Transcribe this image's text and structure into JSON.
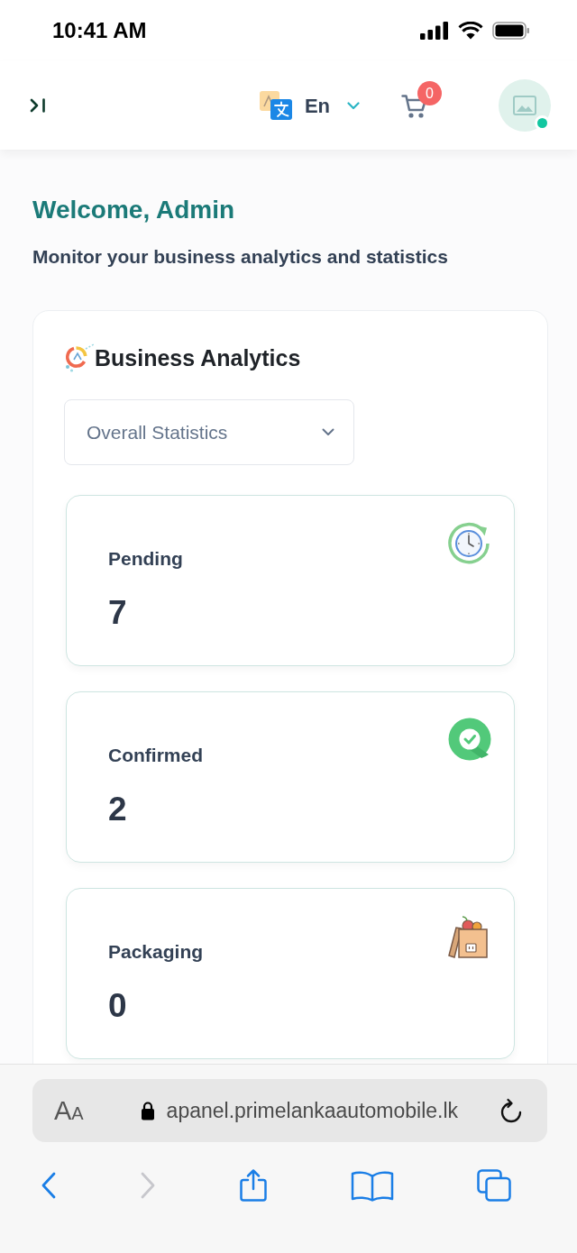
{
  "status_bar": {
    "time": "10:41 AM"
  },
  "header": {
    "language": {
      "label": "En"
    },
    "cart": {
      "count": "0"
    },
    "avatar": {
      "online": true
    }
  },
  "welcome": {
    "title": "Welcome, Admin",
    "subtitle": "Monitor your business analytics and statistics"
  },
  "analytics": {
    "title": "Business Analytics",
    "filter": {
      "value": "Overall Statistics"
    },
    "stats": [
      {
        "kind": "pending",
        "label": "Pending",
        "value": "7"
      },
      {
        "kind": "confirmed",
        "label": "Confirmed",
        "value": "2"
      },
      {
        "kind": "packaging",
        "label": "Packaging",
        "value": "0"
      }
    ]
  },
  "browser": {
    "text_size": "AA",
    "secure": true,
    "url": "apanel.primelankaautomobile.lk",
    "toolbar": [
      {
        "kind": "back",
        "disabled": false
      },
      {
        "kind": "forward",
        "disabled": true
      },
      {
        "kind": "share",
        "disabled": false
      },
      {
        "kind": "bookmarks",
        "disabled": false
      },
      {
        "kind": "tabs",
        "disabled": false
      }
    ]
  }
}
